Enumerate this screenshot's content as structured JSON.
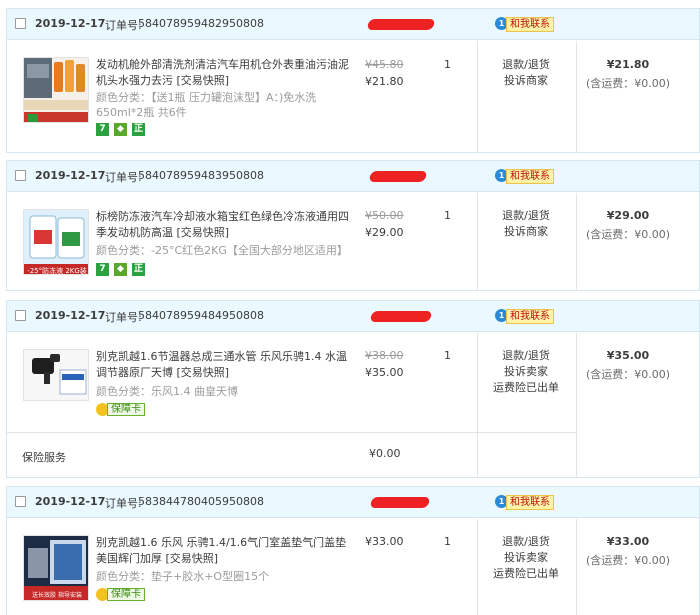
{
  "orders": [
    {
      "date": "2019-12-17",
      "order_label": "订单号:",
      "order_no": "584078959482950808",
      "contact_label": "和我联系",
      "item": {
        "name": "发动机舱外部清洗剂清洁汽车用机仓外表重油污油泥机头水强力去污 [交易快照]",
        "attr": "颜色分类：【送1瓶 压力罐泡沫型】A：)免水洗650ml*2瓶 共6件",
        "price_old": "¥45.80",
        "price_now": "¥21.80",
        "qty": "1",
        "actions": [
          "退款/退货",
          "投诉商家"
        ],
        "total": "¥21.80",
        "freight": "(含运费：¥0.00)"
      }
    },
    {
      "date": "2019-12-17",
      "order_label": "订单号:",
      "order_no": "584078959483950808",
      "contact_label": "和我联系",
      "item": {
        "name": "标榜防冻液汽车冷却液水箱宝红色绿色冷冻液通用四季发动机防高温 [交易快照]",
        "attr": "颜色分类：-25°C红色2KG【全国大部分地区适用】",
        "thumb_caption": "-25°防冻液 2KG装",
        "price_old": "¥50.00",
        "price_now": "¥29.00",
        "qty": "1",
        "actions": [
          "退款/退货",
          "投诉商家"
        ],
        "total": "¥29.00",
        "freight": "(含运费：¥0.00)"
      }
    },
    {
      "date": "2019-12-17",
      "order_label": "订单号:",
      "order_no": "584078959484950808",
      "contact_label": "和我联系",
      "item": {
        "name": "别克凯越1.6节温器总成三通水管 乐风乐骋1.4 水温调节器原厂天博 [交易快照]",
        "attr": "颜色分类：乐风1.4 曲皇天博",
        "guarantee": "保障卡",
        "price_old": "¥38.00",
        "price_now": "¥35.00",
        "qty": "1",
        "actions": [
          "退款/退货",
          "投诉卖家",
          "运费险已出单"
        ],
        "total": "¥35.00",
        "freight": "(含运费：¥0.00)"
      },
      "service": {
        "label": "保险服务",
        "price": "¥0.00"
      }
    },
    {
      "date": "2019-12-17",
      "order_label": "订单号:",
      "order_no": "583844780405950808",
      "contact_label": "和我联系",
      "item": {
        "name": "别克凯越1.6 乐风 乐骋1.4/1.6气门室盖垫气门盖垫 美国辉门加厚 [交易快照]",
        "attr": "颜色分类：垫子+胶水+O型圈15个",
        "guarantee": "保障卡",
        "thumb_caption": "送长效胶 指导安装",
        "price_now": "¥33.00",
        "qty": "1",
        "actions": [
          "退款/退货",
          "投诉卖家",
          "运费险已出单"
        ],
        "total": "¥33.00",
        "freight": "(含运费：¥0.00)"
      }
    }
  ],
  "colors": {
    "header_bg": "#eaf8ff",
    "border": "#d6e6ee",
    "redaction": "#ee2222"
  }
}
